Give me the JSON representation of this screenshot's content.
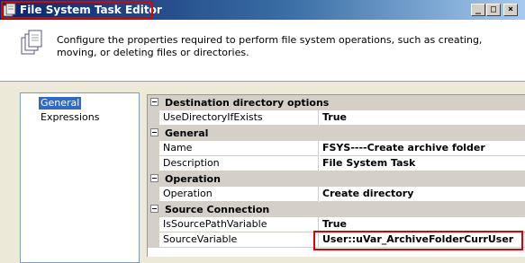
{
  "window": {
    "title": "File System Task Editor",
    "icon": "file-system-task-icon",
    "controls": {
      "minimize": "_",
      "maximize": "□",
      "close": "×"
    }
  },
  "header": {
    "icon": "documents-stack-icon",
    "description": "Configure the properties required to perform file system operations, such as creating, moving, or deleting files or directories."
  },
  "nav": {
    "items": [
      {
        "label": "General",
        "selected": true
      },
      {
        "label": "Expressions",
        "selected": false
      }
    ]
  },
  "grid": {
    "categories": [
      {
        "label": "Destination directory options",
        "properties": [
          {
            "name": "UseDirectoryIfExists",
            "value": "True"
          }
        ]
      },
      {
        "label": "General",
        "properties": [
          {
            "name": "Name",
            "value": "FSYS----Create archive folder"
          },
          {
            "name": "Description",
            "value": "File System Task"
          }
        ]
      },
      {
        "label": "Operation",
        "properties": [
          {
            "name": "Operation",
            "value": "Create directory"
          }
        ]
      },
      {
        "label": "Source Connection",
        "properties": [
          {
            "name": "IsSourcePathVariable",
            "value": "True"
          },
          {
            "name": "SourceVariable",
            "value": "User::uVar_ArchiveFolderCurrUser"
          }
        ]
      }
    ]
  },
  "colors": {
    "highlight": "#e10000",
    "selection": "#316ac5",
    "category": "#d4d0c8"
  }
}
